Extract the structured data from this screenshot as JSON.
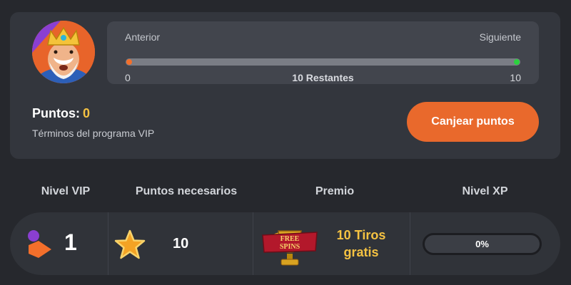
{
  "vip_card": {
    "progress": {
      "prev_label": "Anterior",
      "next_label": "Siguiente",
      "min": "0",
      "max": "10",
      "remaining": "10 Restantes",
      "start_color": "#f36f2b",
      "end_color": "#2bd13d"
    },
    "points_label": "Puntos:",
    "points_value": "0",
    "terms_link": "Términos del programa VIP",
    "redeem_button": "Canjear puntos"
  },
  "table": {
    "headers": [
      "Nivel VIP",
      "Puntos necesarios",
      "Premio",
      "Nivel XP"
    ],
    "rows": [
      {
        "level": "1",
        "points_needed": "10",
        "prize_line1": "10 Tiros",
        "prize_line2": "gratis",
        "prize_icon": "free-spins-trophy-icon",
        "xp_fraction": 0,
        "xp_label": "0%"
      }
    ]
  },
  "colors": {
    "accent": "#e9692c",
    "gold": "#f5c242",
    "background": "#26282d",
    "card": "#33363d"
  }
}
